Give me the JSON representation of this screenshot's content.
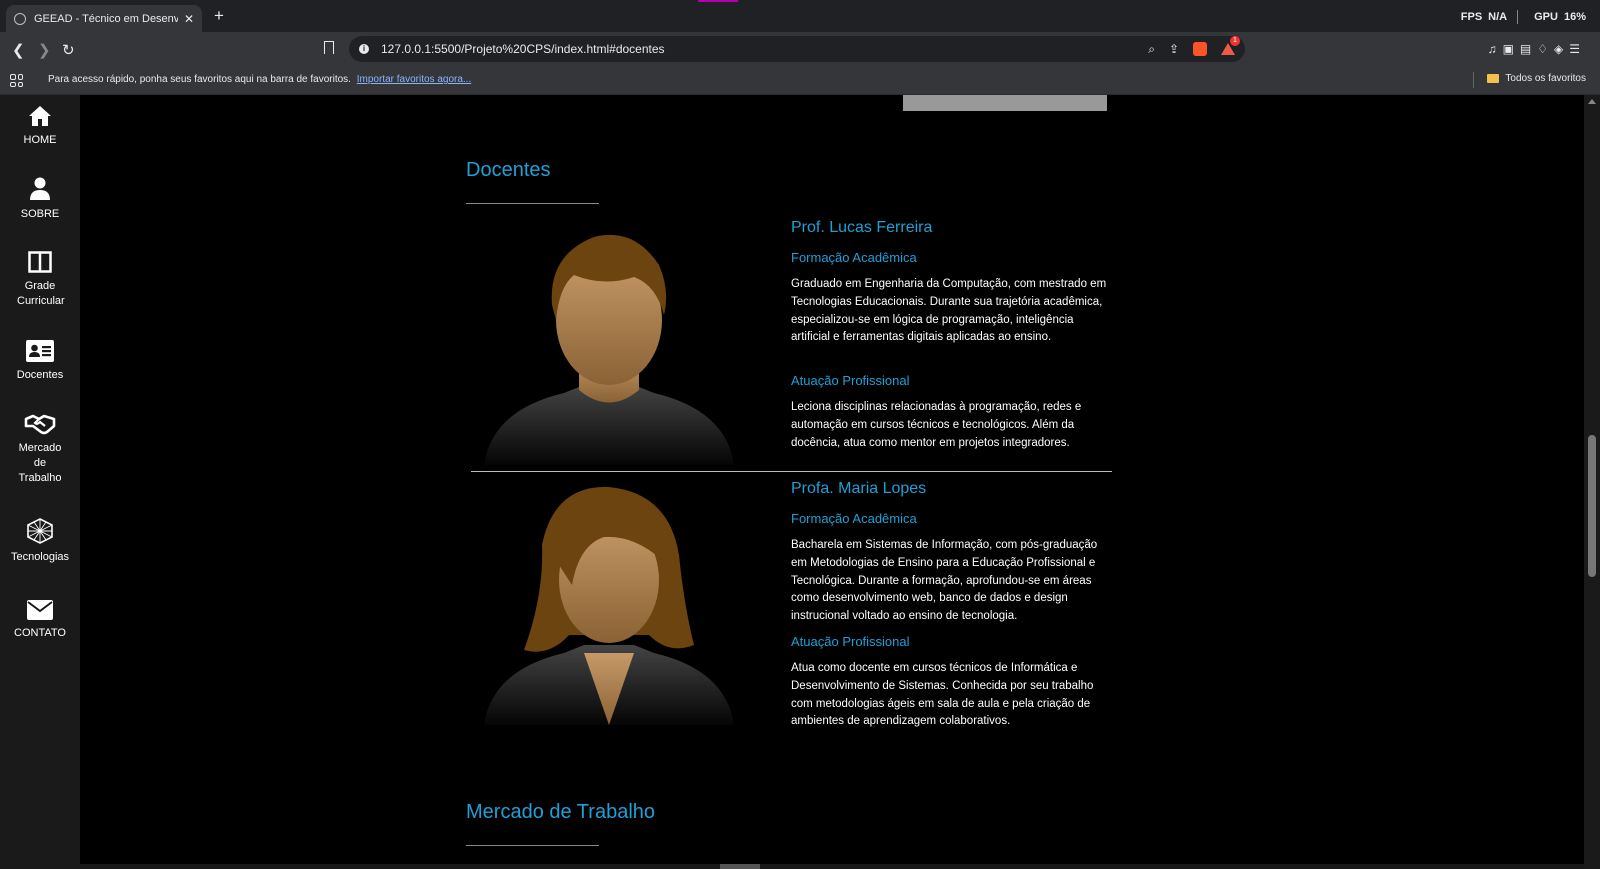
{
  "browser": {
    "tab_title": "GEEAD - Técnico em Desenvolvim",
    "url": "127.0.0.1:5500/Projeto%20CPS/index.html#docentes",
    "stats": {
      "fps_label": "FPS",
      "fps_value": "N/A",
      "gpu_label": "GPU",
      "gpu_value": "16%"
    },
    "bookmarks_text": "Para acesso rápido, ponha seus favoritos aqui na barra de favoritos.",
    "bookmarks_link": "Importar favoritos agora...",
    "all_bookmarks": "Todos os favoritos",
    "reward_badge": "1"
  },
  "sidebar": {
    "items": [
      {
        "label": "HOME",
        "icon": "home-icon"
      },
      {
        "label": "SOBRE",
        "icon": "user-icon"
      },
      {
        "label": "Grade Curricular",
        "icon": "columns-icon"
      },
      {
        "label": "Docentes",
        "icon": "id-card-icon"
      },
      {
        "label": "Mercado de Trabalho",
        "icon": "handshake-icon"
      },
      {
        "label": "Tecnologias",
        "icon": "network-icon"
      },
      {
        "label": "CONTATO",
        "icon": "envelope-icon"
      }
    ]
  },
  "docentes": {
    "title": "Docentes",
    "professors": [
      {
        "name": "Prof. Lucas Ferreira",
        "formation_title": "Formação Acadêmica",
        "formation_text": "Graduado em Engenharia da Computação, com mestrado em Tecnologias Educacionais. Durante sua trajetória acadêmica, especializou-se em lógica de programação, inteligência artificial e ferramentas digitais aplicadas ao ensino.",
        "work_title": "Atuação Profissional",
        "work_text": "Leciona disciplinas relacionadas à programação, redes e automação em cursos técnicos e tecnológicos. Além da docência, atua como mentor em projetos integradores."
      },
      {
        "name": "Profa. Maria Lopes",
        "formation_title": "Formação Acadêmica",
        "formation_text": "Bacharela em Sistemas de Informação, com pós-graduação em Metodologias de Ensino para a Educação Profissional e Tecnológica. Durante a formação, aprofundou-se em áreas como desenvolvimento web, banco de dados e design instrucional voltado ao ensino de tecnologia.",
        "work_title": "Atuação Profissional",
        "work_text": "Atua como docente em cursos técnicos de Informática e Desenvolvimento de Sistemas. Conhecida por seu trabalho com metodologias ágeis em sala de aula e pela criação de ambientes de aprendizagem colaborativos."
      }
    ]
  },
  "next_section": {
    "title": "Mercado de Trabalho"
  },
  "colors": {
    "accent": "#1fa0d6",
    "sidebar_bg": "#1a1a1a",
    "page_bg": "#000000"
  }
}
